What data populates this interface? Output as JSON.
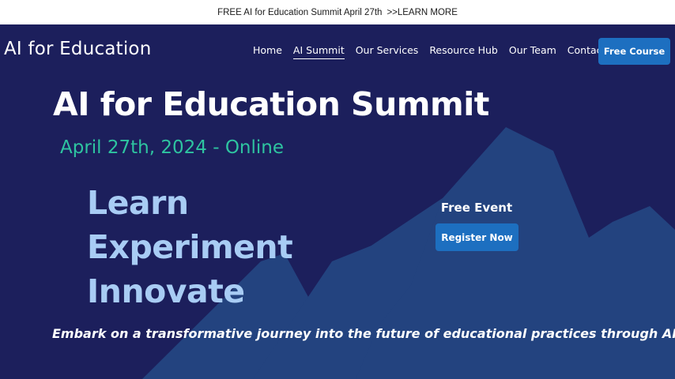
{
  "announcement": {
    "text": "FREE AI for Education Summit April 27th",
    "link": ">>LEARN MORE"
  },
  "header": {
    "logo": "AI for Education",
    "nav": [
      {
        "label": "Home"
      },
      {
        "label": "AI Summit",
        "active": true
      },
      {
        "label": "Our Services"
      },
      {
        "label": "Resource Hub"
      },
      {
        "label": "Our Team"
      },
      {
        "label": "Contact"
      }
    ],
    "cta": "Free Course"
  },
  "hero": {
    "title": "AI for Education Summit",
    "date": "April 27th, 2024 - Online",
    "words": [
      "Learn",
      "Experiment",
      "Innovate"
    ],
    "event_label": "Free Event",
    "register": "Register Now",
    "tagline": "Embark on a transformative journey into the future of educational practices through AI."
  },
  "colors": {
    "background": "#1c1f5c",
    "mountain": "#23437f",
    "accent_button": "#1d6fc0",
    "date_green": "#2ec4a0",
    "words_blue": "#a8ccf4"
  }
}
